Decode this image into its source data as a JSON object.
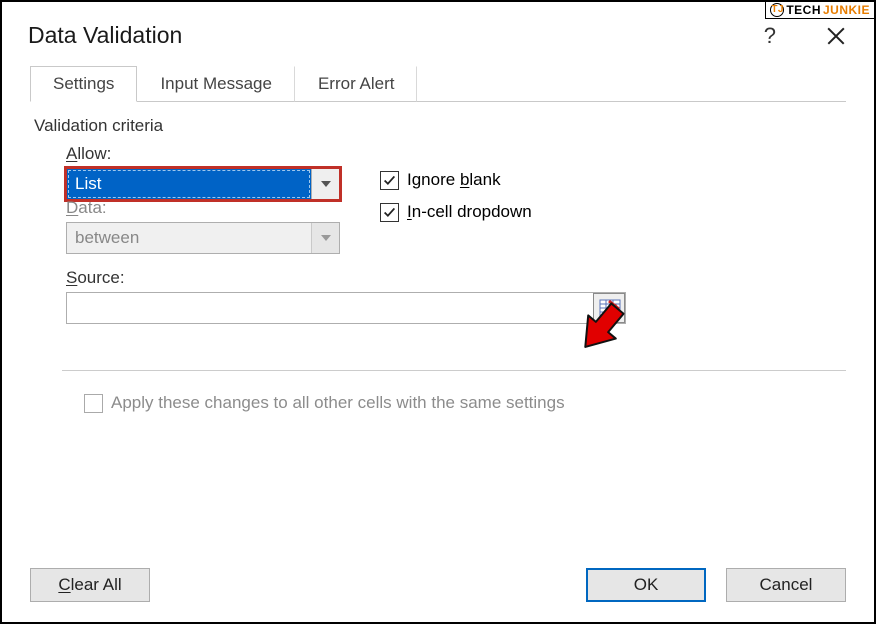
{
  "watermark": {
    "brand_left": "TECH",
    "brand_right": "JUNKIE"
  },
  "title": "Data Validation",
  "tabs": [
    {
      "label": "Settings",
      "active": true
    },
    {
      "label": "Input Message",
      "active": false
    },
    {
      "label": "Error Alert",
      "active": false
    }
  ],
  "criteria": {
    "legend": "Validation criteria",
    "allow": {
      "label": "Allow:",
      "underline": "A",
      "value": "List"
    },
    "data": {
      "label": "Data:",
      "underline": "D",
      "value": "between",
      "disabled": true
    },
    "source": {
      "label": "Source:",
      "underline": "S",
      "value": ""
    }
  },
  "checkboxes": {
    "ignore_blank": {
      "label_pre": "Ignore ",
      "underline": "b",
      "label_post": "lank",
      "checked": true
    },
    "incell": {
      "label_pre": "",
      "underline": "I",
      "label_post": "n-cell dropdown",
      "checked": true
    }
  },
  "apply_all": {
    "label_pre": "Apply these changes to all other cells with the same settings",
    "checked": false,
    "disabled": true
  },
  "buttons": {
    "clear": {
      "pre": "",
      "u": "C",
      "post": "lear All"
    },
    "ok": "OK",
    "cancel": "Cancel"
  }
}
